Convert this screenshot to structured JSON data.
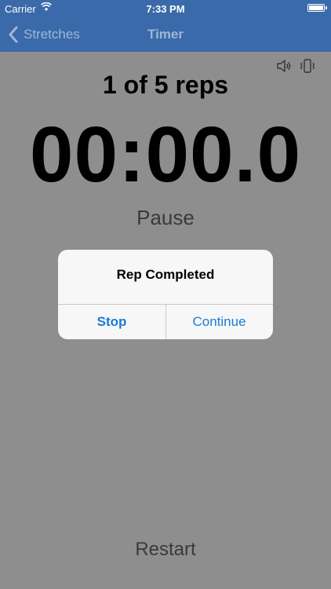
{
  "status_bar": {
    "carrier": "Carrier",
    "time": "7:33 PM"
  },
  "nav": {
    "back_label": "Stretches",
    "title": "Timer"
  },
  "timer": {
    "reps": "1 of 5 reps",
    "time": "00:00.0",
    "pause_label": "Pause",
    "restart_label": "Restart"
  },
  "alert": {
    "title": "Rep Completed",
    "stop_label": "Stop",
    "continue_label": "Continue"
  },
  "colors": {
    "bar": "#3a6aa9",
    "dim_background": "#8e8e8e",
    "alert_button": "#1a7bd6"
  },
  "icons": {
    "wifi": "wifi-icon",
    "battery": "battery-icon",
    "sound": "speaker-icon",
    "vibrate": "vibrate-icon",
    "back": "chevron-left-icon"
  }
}
